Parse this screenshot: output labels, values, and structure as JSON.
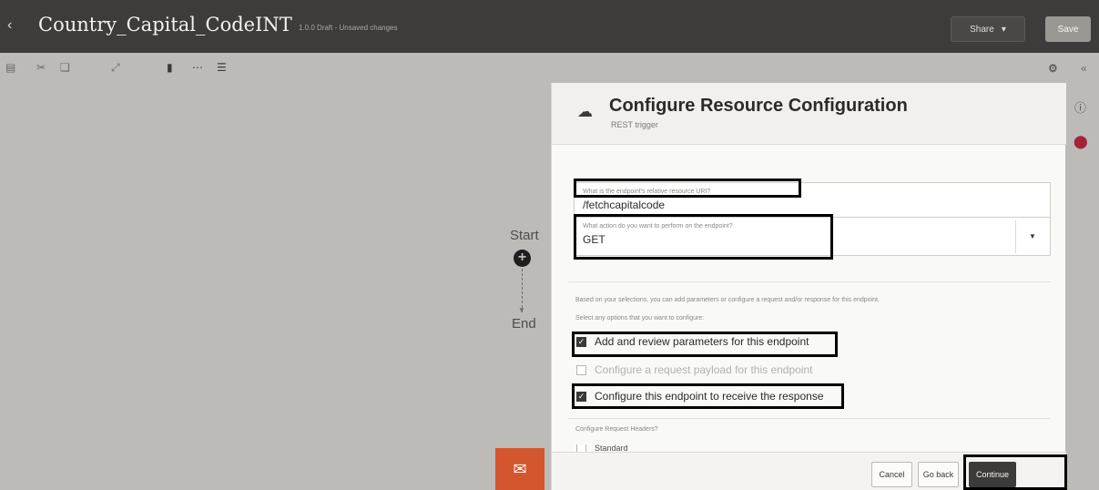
{
  "header": {
    "back_icon": "chevron-left-icon",
    "title": "Country_Capital_CodeINT",
    "status": "1.0.0 Draft - Unsaved changes",
    "share_label": "Share",
    "save_label": "Save"
  },
  "toolbar": {
    "icons": [
      "connect-icon",
      "cut-icon",
      "copy-icon",
      "expand-icon",
      "vertical-layout-icon",
      "horizontal-layout-icon",
      "pancake-layout-icon"
    ],
    "right_icons": [
      "settings-icon",
      "collapse-icon"
    ]
  },
  "canvas": {
    "start_label": "Start",
    "end_label": "End"
  },
  "drawer": {
    "title": "Configure Resource Configuration",
    "subtitle": "REST trigger",
    "uri_field": {
      "label": "What is the endpoint's relative resource URI?",
      "value": "/fetchcapitalcode"
    },
    "action_field": {
      "label": "What action do you want to perform on the endpoint?",
      "value": "GET"
    },
    "note_1": "Based on your selections, you can add parameters or configure a request and/or response for this endpoint.",
    "note_2": "Select any options that you want to configure:",
    "options": [
      {
        "label": "Add and review parameters for this endpoint",
        "checked": true
      },
      {
        "label": "Configure a request payload for this endpoint",
        "checked": false
      },
      {
        "label": "Configure this endpoint to receive the response",
        "checked": true
      }
    ],
    "headers_label": "Configure Request Headers?",
    "standard_label": "Standard",
    "buttons": {
      "cancel": "Cancel",
      "go_back": "Go back",
      "continue": "Continue"
    }
  },
  "colors": {
    "header_bg": "#3d3c3b",
    "canvas_bg": "#bdbbb8",
    "chat_button": "#d4562f",
    "primary_button": "#3c3b39",
    "highlight_box": "#000000"
  }
}
